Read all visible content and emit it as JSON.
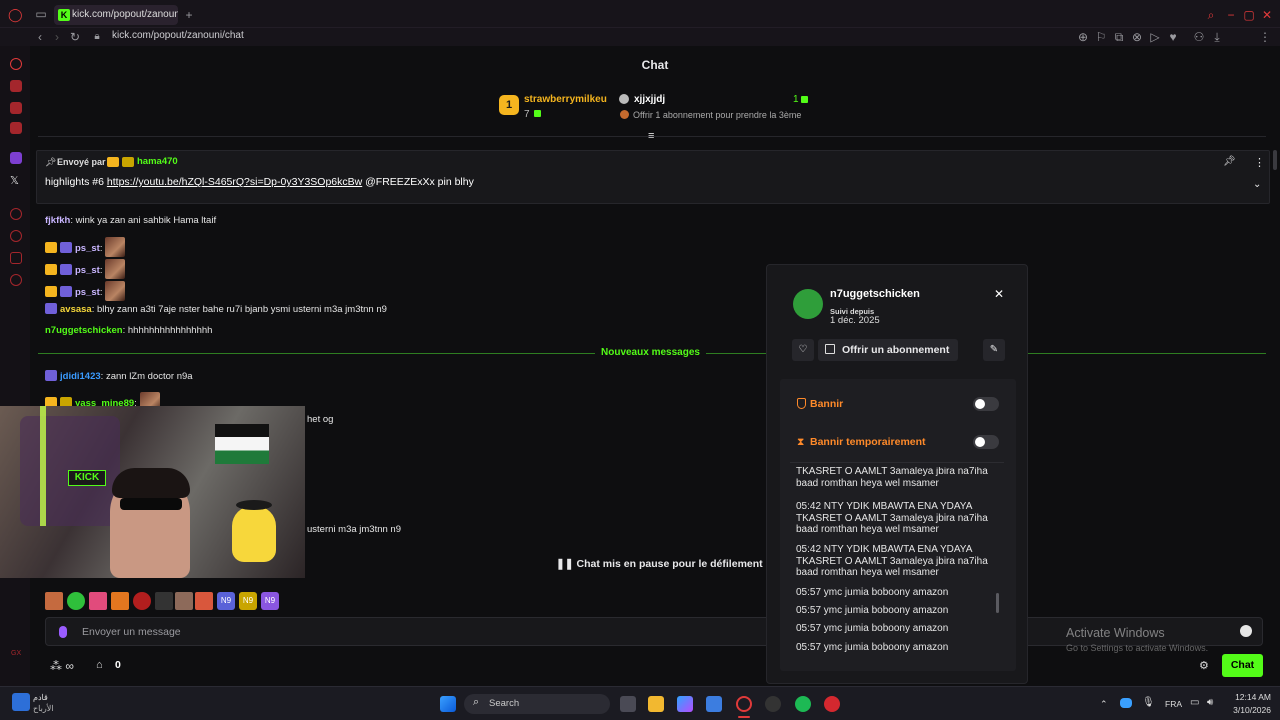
{
  "browser": {
    "tab_title": "kick.com/popout/zanouni/",
    "url": "kick.com/popout/zanouni/chat",
    "ai_label": "AI"
  },
  "chat": {
    "title": "Chat",
    "leaderboard": {
      "first_rank": "1",
      "first_name": "strawberrymilkeu",
      "first_count": "7",
      "second_name": "xjjxjjdj",
      "second_count": "1",
      "gift_text": "Offrir 1 abonnement pour prendre la 3ème"
    },
    "pinned": {
      "sent_by": "Envoyé par",
      "author": "hama470",
      "text_prefix": "highlights #6 ",
      "link": "https://youtu.be/hZQl-S465rQ?si=Dp-0y3Y3SOp6kcBw",
      "text_suffix": " @FREEZExXx pin blhy"
    },
    "messages": [
      {
        "user": "fjkfkh",
        "text": ": wink ya zan ani sahbik Hama ltaif"
      },
      {
        "user": "ps_st",
        "text": ":"
      },
      {
        "user": "ps_st",
        "text": ":"
      },
      {
        "user": "ps_st",
        "text": ":"
      },
      {
        "user": "avsasa",
        "text": ": blhy zann a3ti 7aje nster bahe ru7i bjanb ysmi usterni m3a jm3tnn n9"
      },
      {
        "user": "n7uggetschicken",
        "text": ": hhhhhhhhhhhhhhhh"
      },
      {
        "user": "jdidi1423",
        "text": ": zann lZm doctor n9a"
      },
      {
        "user": "yass_mine89",
        "text": ":"
      }
    ],
    "partial_1": "het og",
    "partial_2": "usterni m3a jm3tnn n9",
    "new_messages": "Nouveaux messages",
    "paused": "Chat mis en pause pour le défilement",
    "input_placeholder": "Envoyer un message",
    "points": "0",
    "send_button": "Chat"
  },
  "card": {
    "username": "n7uggetschicken",
    "follow_label": "Suivi depuis",
    "follow_date": "1 déc. 2025",
    "gift_button": "Offrir un abonnement",
    "ban_label": "Bannir",
    "timeout_label": "Bannir temporairement",
    "log": [
      {
        "text": "TKASRET O AAMLT 3amaleya jbira na7iha baad romthan heya wel msamer"
      },
      {
        "text": "05:42 NTY YDIK MBAWTA ENA YDAYA TKASRET O AAMLT 3amaleya jbira na7iha baad romthan heya wel msamer"
      },
      {
        "text": "05:42 NTY YDIK MBAWTA ENA YDAYA TKASRET O AAMLT 3amaleya jbira na7iha baad romthan heya wel msamer"
      },
      {
        "text": "05:57 ymc jumia boboony amazon"
      },
      {
        "text": "05:57 ymc jumia boboony amazon"
      },
      {
        "text": "05:57 ymc jumia boboony amazon"
      },
      {
        "text": "05:57 ymc jumia boboony amazon"
      }
    ]
  },
  "watermark": {
    "title": "Activate Windows",
    "subtitle": "Go to Settings to activate Windows."
  },
  "taskbar": {
    "weather_line1": "قادم",
    "weather_line2": "الأرباح",
    "search": "Search",
    "lang": "FRA",
    "time": "12:14 AM",
    "date": "3/10/2026"
  },
  "colors": {
    "kick_green": "#53fc18",
    "orange": "#ff8a2a",
    "gold": "#f5b51f"
  }
}
